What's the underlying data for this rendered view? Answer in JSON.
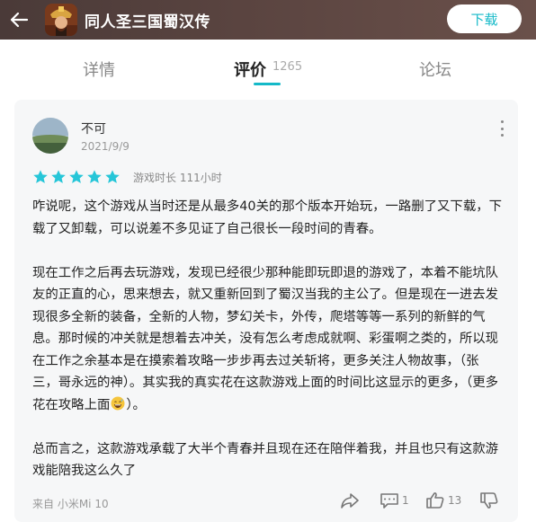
{
  "header": {
    "app_title": "同人圣三国蜀汉传",
    "download_label": "下载",
    "icons": {
      "back": "arrow-left-icon",
      "app": "game-app-icon"
    }
  },
  "tabs": [
    {
      "label": "详情",
      "active": false
    },
    {
      "label": "评价",
      "active": true,
      "count": "1265"
    },
    {
      "label": "论坛",
      "active": false
    }
  ],
  "review": {
    "user_name": "不可",
    "date": "2021/9/9",
    "rating": 5,
    "play_time": "游戏时长 111小时",
    "paragraphs": [
      "咋说呢，这个游戏从当时还是从最多40关的那个版本开始玩，一路删了又下载，下载了又卸载，可以说差不多见证了自己很长一段时间的青春。",
      "现在工作之后再去玩游戏，发现已经很少那种能即玩即退的游戏了，本着不能坑队友的正直的心，思来想去，就又重新回到了蜀汉当我的主公了。但是现在一进去发现很多全新的装备，全新的人物，梦幻关卡，外传，爬塔等等一系列的新鲜的气息。那时候的冲关就是想着去冲关，没有怎么考虑成就啊、彩蛋啊之类的，所以现在工作之余基本是在摸索着攻略一步步再去过关斩将，更多关注人物故事，（张三，哥永远的神）。其实我的真实花在这款游戏上面的时间比这显示的更多，（更多花在攻略上面",
      "总而言之，这款游戏承载了大半个青春并且现在还在陪伴着我，并且也只有这款游戏能陪我这么久了"
    ],
    "emoji_tail": "）。",
    "emoji": "grinning-sweat-emoji",
    "device": "来自 小米Mi 10",
    "reply_count": "1",
    "like_count": "13"
  },
  "colors": {
    "accent": "#14b9c8",
    "star": "#26c6d8",
    "header_bg": "#4f3d3a"
  }
}
